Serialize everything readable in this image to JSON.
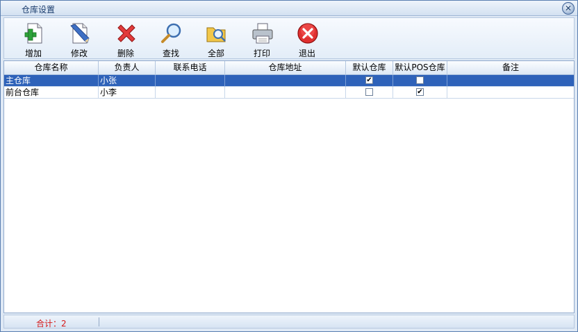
{
  "window": {
    "title": "仓库设置"
  },
  "toolbar": {
    "buttons": [
      {
        "label": "增加",
        "icon": "add-doc-icon"
      },
      {
        "label": "修改",
        "icon": "edit-doc-icon"
      },
      {
        "label": "删除",
        "icon": "red-x-icon"
      },
      {
        "label": "查找",
        "icon": "magnifier-icon"
      },
      {
        "label": "全部",
        "icon": "folder-search-icon"
      },
      {
        "label": "打印",
        "icon": "printer-icon"
      },
      {
        "label": "退出",
        "icon": "exit-circle-icon"
      }
    ]
  },
  "table": {
    "columns": [
      "仓库名称",
      "负责人",
      "联系电话",
      "仓库地址",
      "默认仓库",
      "默认POS仓库",
      "备注"
    ],
    "rows": [
      {
        "name": "主仓库",
        "manager": "小张",
        "phone": "",
        "address": "",
        "default": true,
        "default_pos": false,
        "note": "",
        "selected": true
      },
      {
        "name": "前台仓库",
        "manager": "小李",
        "phone": "",
        "address": "",
        "default": false,
        "default_pos": true,
        "note": "",
        "selected": false
      }
    ]
  },
  "status": {
    "total_text": "合计：2"
  },
  "colors": {
    "selected_row": "#2e62b9",
    "total_text": "#d41818",
    "accent": "#5a7fb0"
  }
}
